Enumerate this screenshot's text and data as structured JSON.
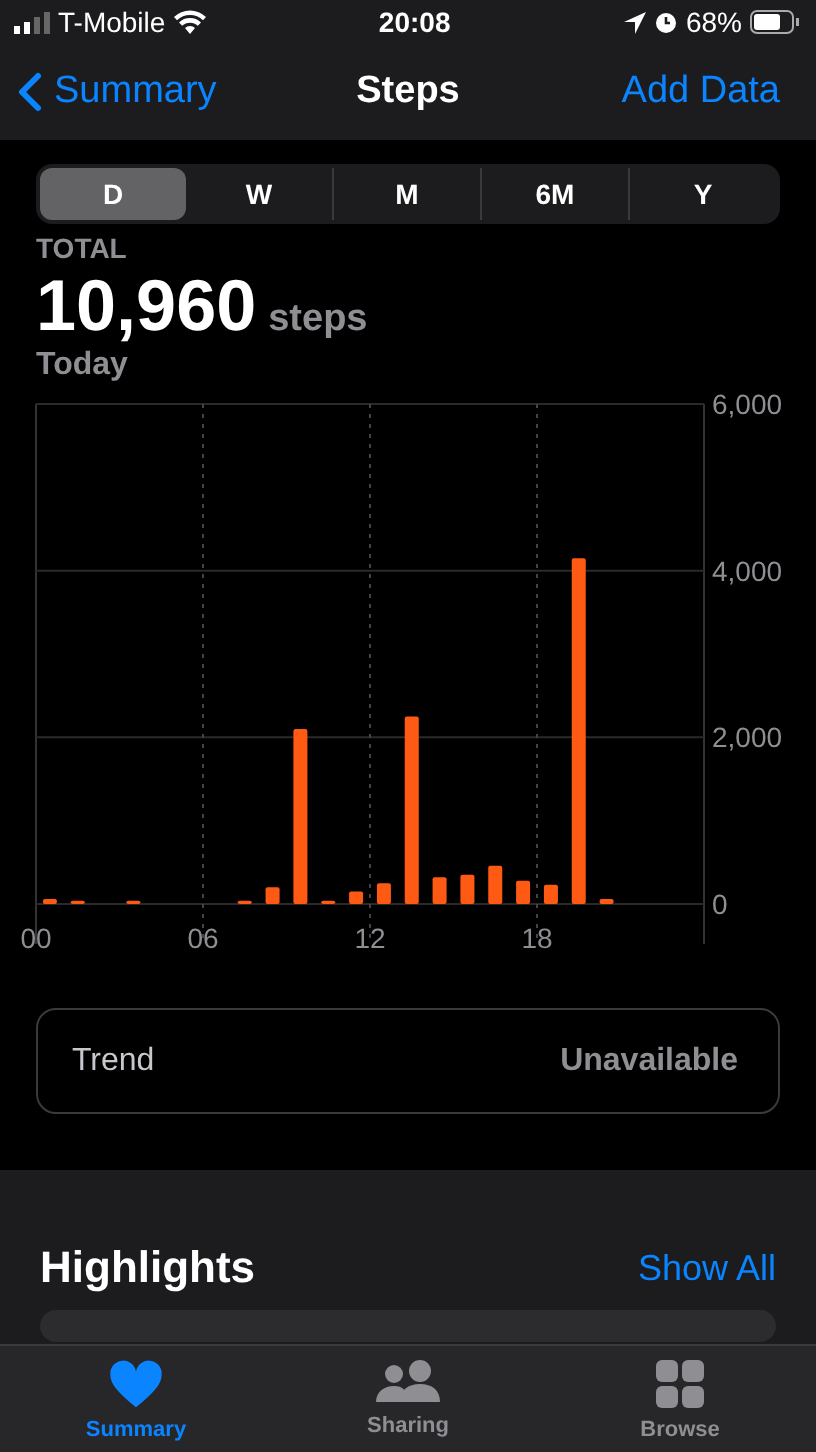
{
  "status_bar": {
    "carrier": "T-Mobile",
    "time": "20:08",
    "battery": "68%"
  },
  "nav": {
    "back": "Summary",
    "title": "Steps",
    "action": "Add Data"
  },
  "ranges": [
    {
      "label": "D",
      "selected": true
    },
    {
      "label": "W",
      "selected": false
    },
    {
      "label": "M",
      "selected": false
    },
    {
      "label": "6M",
      "selected": false
    },
    {
      "label": "Y",
      "selected": false
    }
  ],
  "summary": {
    "label": "TOTAL",
    "value": "10,960",
    "unit": "steps",
    "period": "Today"
  },
  "chart_data": {
    "type": "bar",
    "x": [
      0.5,
      1.5,
      2.5,
      3.5,
      4.5,
      5.5,
      6.5,
      7.5,
      8.5,
      9.5,
      10.5,
      11.5,
      12.5,
      13.5,
      14.5,
      15.5,
      16.5,
      17.5,
      18.5,
      19.5,
      20.5,
      21.5,
      22.5,
      23.5
    ],
    "series": [
      {
        "color": "#ff5a14",
        "values": [
          60,
          40,
          0,
          40,
          0,
          0,
          0,
          40,
          200,
          2100,
          40,
          150,
          250,
          2250,
          320,
          350,
          460,
          280,
          230,
          4150,
          60,
          0,
          0,
          0
        ]
      }
    ],
    "grid": true,
    "xlim": [
      0,
      24
    ],
    "ylim": [
      0,
      6000
    ],
    "xticks": [
      {
        "value": 0,
        "label": "00"
      },
      {
        "value": 6,
        "label": "06"
      },
      {
        "value": 12,
        "label": "12"
      },
      {
        "value": 18,
        "label": "18"
      }
    ],
    "yticks": [
      {
        "value": 0,
        "label": "0"
      },
      {
        "value": 2000,
        "label": "2,000"
      },
      {
        "value": 4000,
        "label": "4,000"
      },
      {
        "value": 6000,
        "label": "6,000"
      }
    ]
  },
  "trend": {
    "label": "Trend",
    "value": "Unavailable"
  },
  "highlights": {
    "title": "Highlights",
    "action": "Show All"
  },
  "tab_bar": [
    {
      "label": "Summary",
      "kind": "heart",
      "selected": true
    },
    {
      "label": "Sharing",
      "kind": "people",
      "selected": false
    },
    {
      "label": "Browse",
      "kind": "grid",
      "selected": false
    }
  ]
}
